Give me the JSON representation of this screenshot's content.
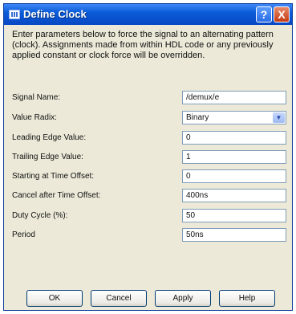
{
  "window": {
    "title": "Define Clock",
    "help_glyph": "?",
    "close_glyph": "X"
  },
  "intro_text": "Enter parameters below to force the signal to an alternating pattern (clock). Assignments made from within HDL code or any previously applied constant or clock force will be overridden.",
  "fields": [
    {
      "label": "Signal Name:",
      "value": "/demux/e"
    },
    {
      "label": "Value Radix:",
      "value": "Binary",
      "type": "combo"
    },
    {
      "label": "Leading Edge Value:",
      "value": "0"
    },
    {
      "label": "Trailing Edge Value:",
      "value": "1"
    },
    {
      "label": "Starting at Time Offset:",
      "value": "0"
    },
    {
      "label": "Cancel after Time Offset:",
      "value": "400ns"
    },
    {
      "label": "Duty Cycle (%):",
      "value": "50"
    },
    {
      "label": "Period",
      "value": "50ns"
    }
  ],
  "buttons": {
    "ok": "OK",
    "cancel": "Cancel",
    "apply": "Apply",
    "help": "Help"
  },
  "colors": {
    "titlebar": "#0a5cd8",
    "dialog_bg": "#ece9d8",
    "field_border": "#7f9db9"
  },
  "icons": {
    "title": "clock-wave-icon",
    "combo": "chevron-down-icon"
  }
}
